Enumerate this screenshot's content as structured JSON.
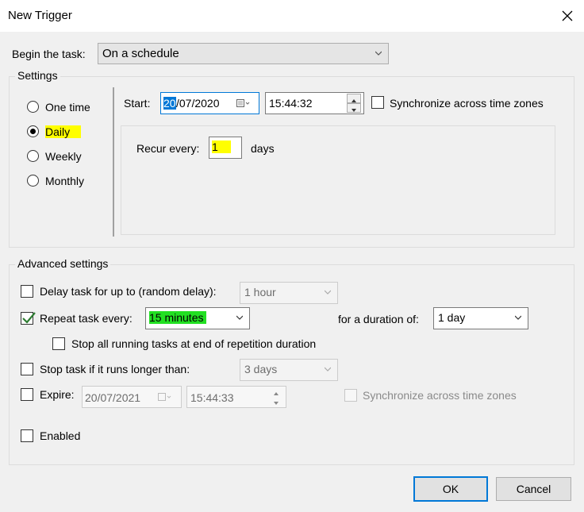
{
  "window": {
    "title": "New Trigger"
  },
  "begin": {
    "label": "Begin the task:",
    "value": "On a schedule"
  },
  "settings": {
    "label": "Settings",
    "options": [
      "One time",
      "Daily",
      "Weekly",
      "Monthly"
    ],
    "selected": "Daily",
    "start_label": "Start:",
    "start_date_day": "20",
    "start_date_rest": "/07/2020",
    "start_time": "15:44:32",
    "sync_label": "Synchronize across time zones",
    "recur_label": "Recur every:",
    "recur_value": "1",
    "recur_unit": "days"
  },
  "advanced": {
    "label": "Advanced settings",
    "delay_label": "Delay task for up to (random delay):",
    "delay_value": "1 hour",
    "repeat_label": "Repeat task every:",
    "repeat_value": "15 minutes",
    "duration_label": "for a duration of:",
    "duration_value": "1 day",
    "stop_running_label": "Stop all running tasks at end of repetition duration",
    "stop_longer_label": "Stop task if it runs longer than:",
    "stop_longer_value": "3 days",
    "expire_label": "Expire:",
    "expire_date": "20/07/2021",
    "expire_time": "15:44:33",
    "expire_sync_label": "Synchronize across time zones",
    "enabled_label": "Enabled"
  },
  "buttons": {
    "ok": "OK",
    "cancel": "Cancel"
  },
  "icons": [
    "close-icon",
    "chevron-down-icon",
    "calendar-icon",
    "spin-up-icon",
    "spin-down-icon",
    "checkmark-icon"
  ],
  "colors": {
    "selection": "#0078d7",
    "yellow_highlight": "#ffff00",
    "green_highlight": "#22e022",
    "checkmark": "#2e7d32"
  }
}
